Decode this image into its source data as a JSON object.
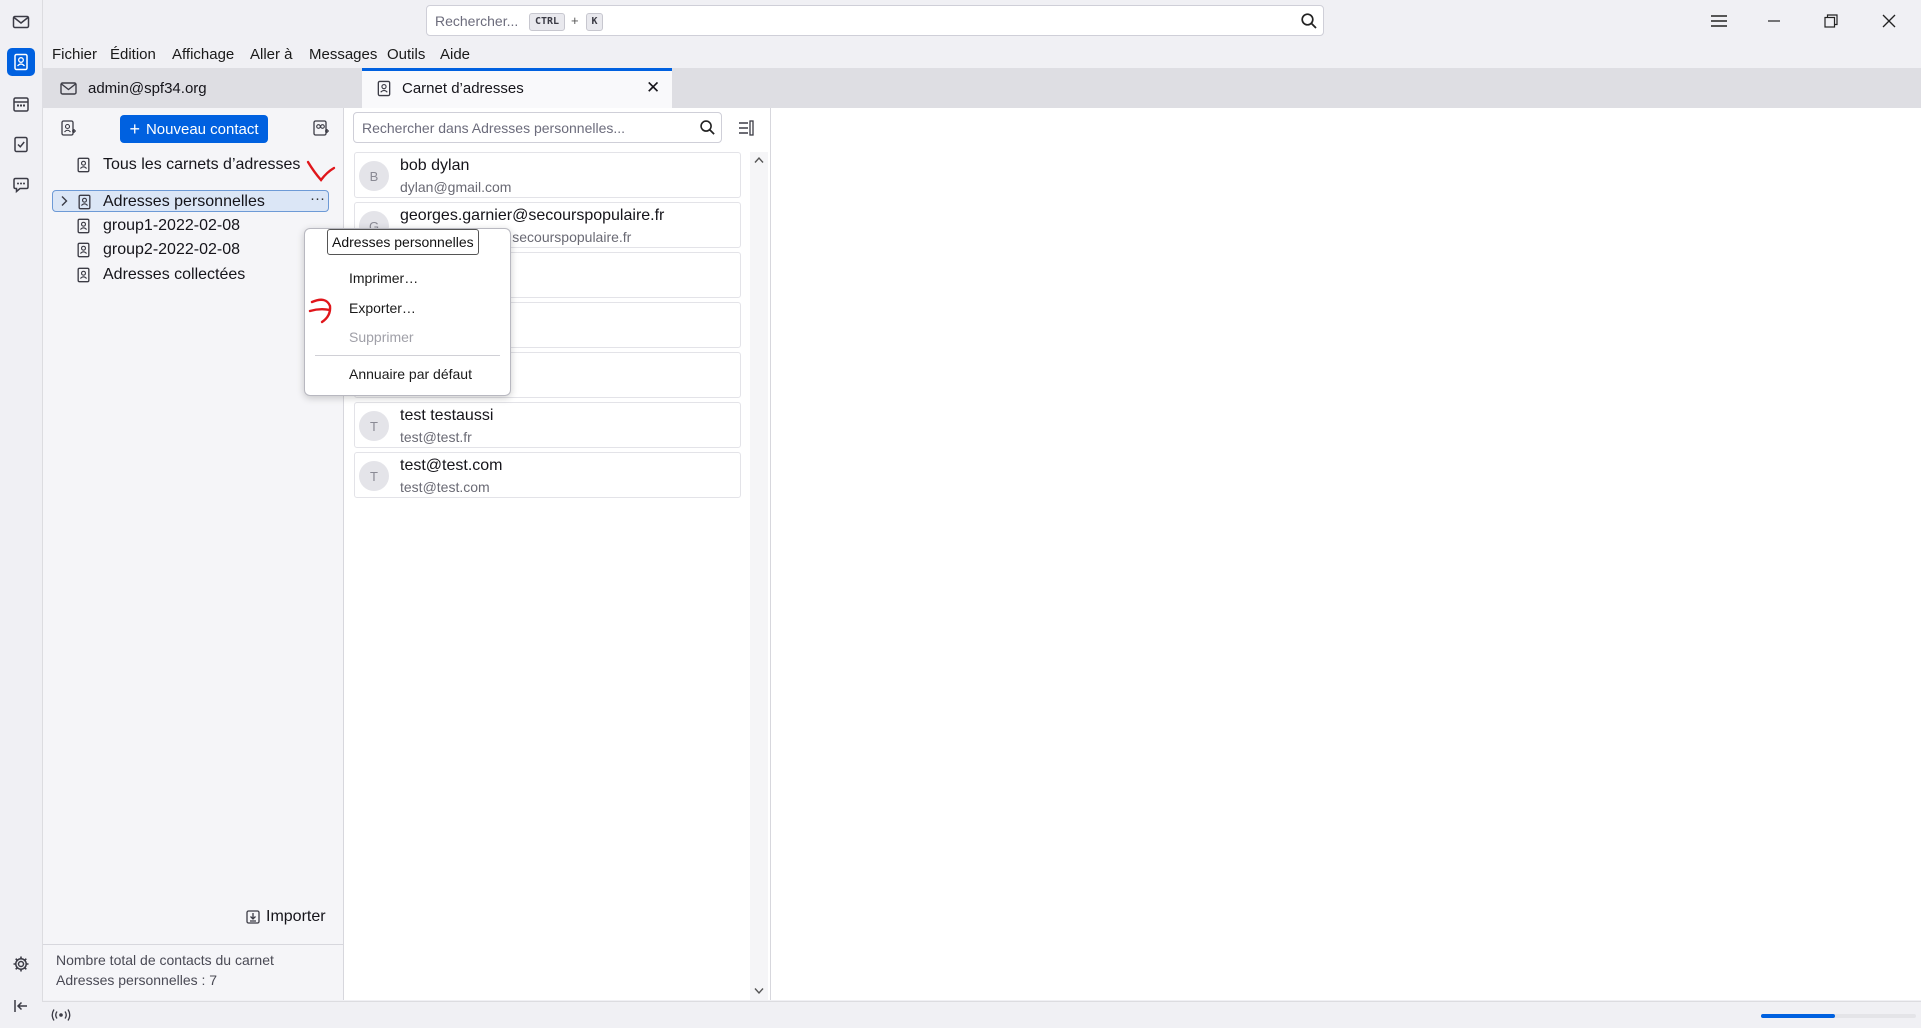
{
  "window": {
    "search_placeholder": "Rechercher...",
    "shortcut_ctrl": "CTRL",
    "shortcut_plus": "+",
    "shortcut_key": "K"
  },
  "menubar": [
    "Fichier",
    "Édition",
    "Affichage",
    "Aller à",
    "Messages",
    "Outils",
    "Aide"
  ],
  "tabs": [
    {
      "label": "admin@spf34.org"
    },
    {
      "label": "Carnet d’adresses",
      "close": "✕"
    }
  ],
  "books": {
    "new_contact_label": "Nouveau contact",
    "items": [
      "Tous les carnets d’adresses",
      "Adresses personnelles",
      "group1-2022-02-08",
      "group2-2022-02-08",
      "Adresses collectées"
    ],
    "import_label": "Importer",
    "total_line1": "Nombre total de contacts du carnet",
    "total_line2": "Adresses personnelles : 7"
  },
  "list": {
    "search_placeholder": "Rechercher dans Adresses personnelles...",
    "contacts": [
      {
        "initial": "B",
        "name": "bob dylan",
        "email": "dylan@gmail.com"
      },
      {
        "initial": "G",
        "name": "georges.garnier@secourspopulaire.fr",
        "email": "georges.garnier@secourspopulaire.fr"
      },
      {
        "initial": "",
        "name": "",
        "email": ""
      },
      {
        "initial": "",
        "name": "",
        "email": ""
      },
      {
        "initial": "",
        "name": "",
        "email": ""
      },
      {
        "initial": "T",
        "name": "test testaussi",
        "email": "test@test.fr"
      },
      {
        "initial": "T",
        "name": "test@test.com",
        "email": "test@test.com"
      }
    ]
  },
  "context_menu": {
    "tooltip": "Adresses personnelles",
    "items": [
      {
        "label": "Imprimer…",
        "disabled": false
      },
      {
        "label": "Exporter…",
        "disabled": false
      },
      {
        "label": "Supprimer",
        "disabled": true
      },
      {
        "label": "Annuaire par défaut",
        "disabled": false
      }
    ]
  },
  "colors": {
    "accent": "#0061e0",
    "annotation": "#e0161b"
  }
}
